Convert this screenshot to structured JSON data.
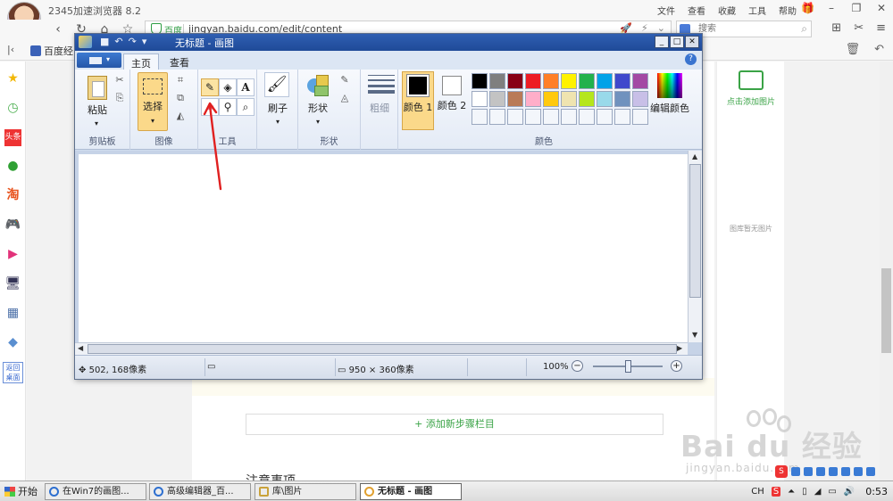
{
  "browser": {
    "title": "2345加速浏览器 8.2",
    "menus": [
      "文件",
      "查看",
      "收藏",
      "工具",
      "帮助"
    ],
    "secure_label": "百度",
    "url": "jingyan.baidu.com/edit/content",
    "search_placeholder": "搜索",
    "bookmark": "百度经"
  },
  "sidebar": {
    "shortcut_label": "返回桌面",
    "icons": [
      "star-icon",
      "clock-icon",
      "news-icon",
      "wechat-icon",
      "taobao-icon",
      "gamepad-icon",
      "video-icon",
      "monitor-icon",
      "calculator-icon",
      "eraser-icon"
    ],
    "taobao_glyph": "淘"
  },
  "page": {
    "add_step": "+ 添加新步骤栏目",
    "faded_heading": "注意事项",
    "add_image": "点击添加图片",
    "no_image": "图库暂无图片"
  },
  "watermark": {
    "brand": "Bai du 经验",
    "sub": "jingyan.baidu.com"
  },
  "paint": {
    "title": "无标题 - 画图",
    "tabs": {
      "home": "主页",
      "view": "查看"
    },
    "groups": {
      "clipboard": "剪贴板",
      "image": "图像",
      "tools": "工具",
      "shapes": "形状",
      "colors": "颜色"
    },
    "buttons": {
      "paste": "粘贴",
      "select": "选择",
      "brushes": "刷子",
      "shapes": "形状",
      "size": "粗细",
      "color1": "颜色 1",
      "color2": "颜色 2",
      "edit_colors": "编辑颜色"
    },
    "palette_row1": [
      "#000000",
      "#7f7f7f",
      "#880015",
      "#ed1c24",
      "#ff7f27",
      "#fff200",
      "#22b14c",
      "#00a2e8",
      "#3f48cc",
      "#a349a4"
    ],
    "palette_row2": [
      "#ffffff",
      "#c3c3c3",
      "#b97a57",
      "#ffaec9",
      "#ffc90e",
      "#efe4b0",
      "#b5e61d",
      "#99d9ea",
      "#7092be",
      "#c8bfe7"
    ],
    "status": {
      "cursor": "502, 168像素",
      "size_separator": "×",
      "canvas_size_w": "950",
      "canvas_size_h": "360像素",
      "zoom": "100%"
    }
  },
  "taskbar": {
    "start": "开始",
    "tasks": [
      "在Win7的画图...",
      "高级编辑器_百...",
      "库\\图片",
      "无标题 - 画图"
    ],
    "lang": "CH",
    "clock": "0:53"
  },
  "colors": {
    "accent_green": "#3aa346",
    "paint_title": "#2f5fb2",
    "annotation_red": "#e02020"
  }
}
